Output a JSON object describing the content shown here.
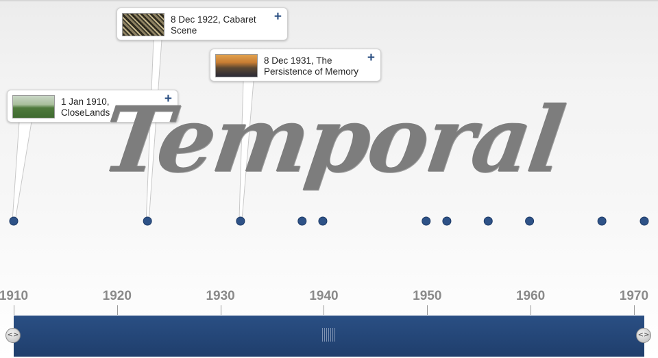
{
  "events": [
    {
      "date_title": "1 Jan 1910, CloseLands",
      "line1": "1 Jan 1910,",
      "line2": "CloseLands",
      "year": 1910.0,
      "card_icon": "plus-icon",
      "thumb": "cloudlands-thumbnail"
    },
    {
      "date_title": "8 Dec 1922, Cabaret Scene",
      "line1": "8 Dec 1922, Cabaret",
      "line2": "Scene",
      "year": 1922.94,
      "card_icon": "plus-icon",
      "thumb": "cabaret-thumbnail"
    },
    {
      "date_title": "8 Dec 1931, The Persistence of Memory",
      "line1": "8 Dec 1931, The",
      "line2": "Persistence of Memory",
      "year": 1931.94,
      "card_icon": "plus-icon",
      "thumb": "persistence-thumbnail"
    }
  ],
  "marker_years": [
    1910.0,
    1922.94,
    1931.94,
    1937.9,
    1939.9,
    1949.9,
    1951.9,
    1955.9,
    1959.9,
    1966.9,
    1971.0
  ],
  "axis": {
    "ticks": [
      "1910",
      "1920",
      "1930",
      "1940",
      "1950",
      "1960",
      "1970"
    ],
    "tick_values": [
      1910,
      1920,
      1930,
      1940,
      1950,
      1960,
      1970
    ],
    "range": [
      1910,
      1971
    ]
  },
  "wordmark": {
    "text": "Temporal"
  },
  "scrubber": {
    "left_handle_icon": "left-right-arrows-icon",
    "right_handle_icon": "left-right-arrows-icon",
    "grip_icon": "grip-icon"
  },
  "plus_glyph": "+",
  "handle_glyph": "<>",
  "colors": {
    "accent": "#2b4f82",
    "bar": "#234675",
    "marker": "#2e5287",
    "axis_text": "#8a8a8a",
    "wordmark": "#7d7d7d"
  }
}
